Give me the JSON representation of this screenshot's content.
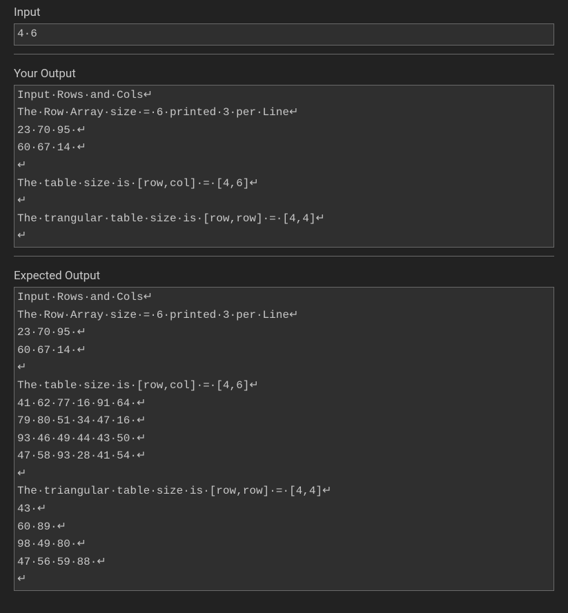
{
  "sections": {
    "input": {
      "title": "Input",
      "lines": [
        "4 6"
      ]
    },
    "your_output": {
      "title": "Your Output",
      "lines": [
        "Input Rows and Cols\n",
        "The Row Array size = 6 printed 3 per Line\n",
        "23 70 95 \n",
        "60 67 14 \n",
        "\n",
        "The table size is [row,col] = [4,6]\n",
        "\n",
        "The trangular table size is [row,row] = [4,4]\n",
        "\n"
      ]
    },
    "expected_output": {
      "title": "Expected Output",
      "lines": [
        "Input Rows and Cols\n",
        "The Row Array size = 6 printed 3 per Line\n",
        "23 70 95 \n",
        "60 67 14 \n",
        "\n",
        "The table size is [row,col] = [4,6]\n",
        "41 62 77 16 91 64 \n",
        "79 80 51 34 47 16 \n",
        "93 46 49 44 43 50 \n",
        "47 58 93 28 41 54 \n",
        "\n",
        "The triangular table size is [row,row] = [4,4]\n",
        "43 \n",
        "60 89 \n",
        "98 49 80 \n",
        "47 56 59 88 \n",
        "\n"
      ]
    }
  },
  "whitespace_symbols": {
    "space": "·",
    "newline": "↵"
  }
}
